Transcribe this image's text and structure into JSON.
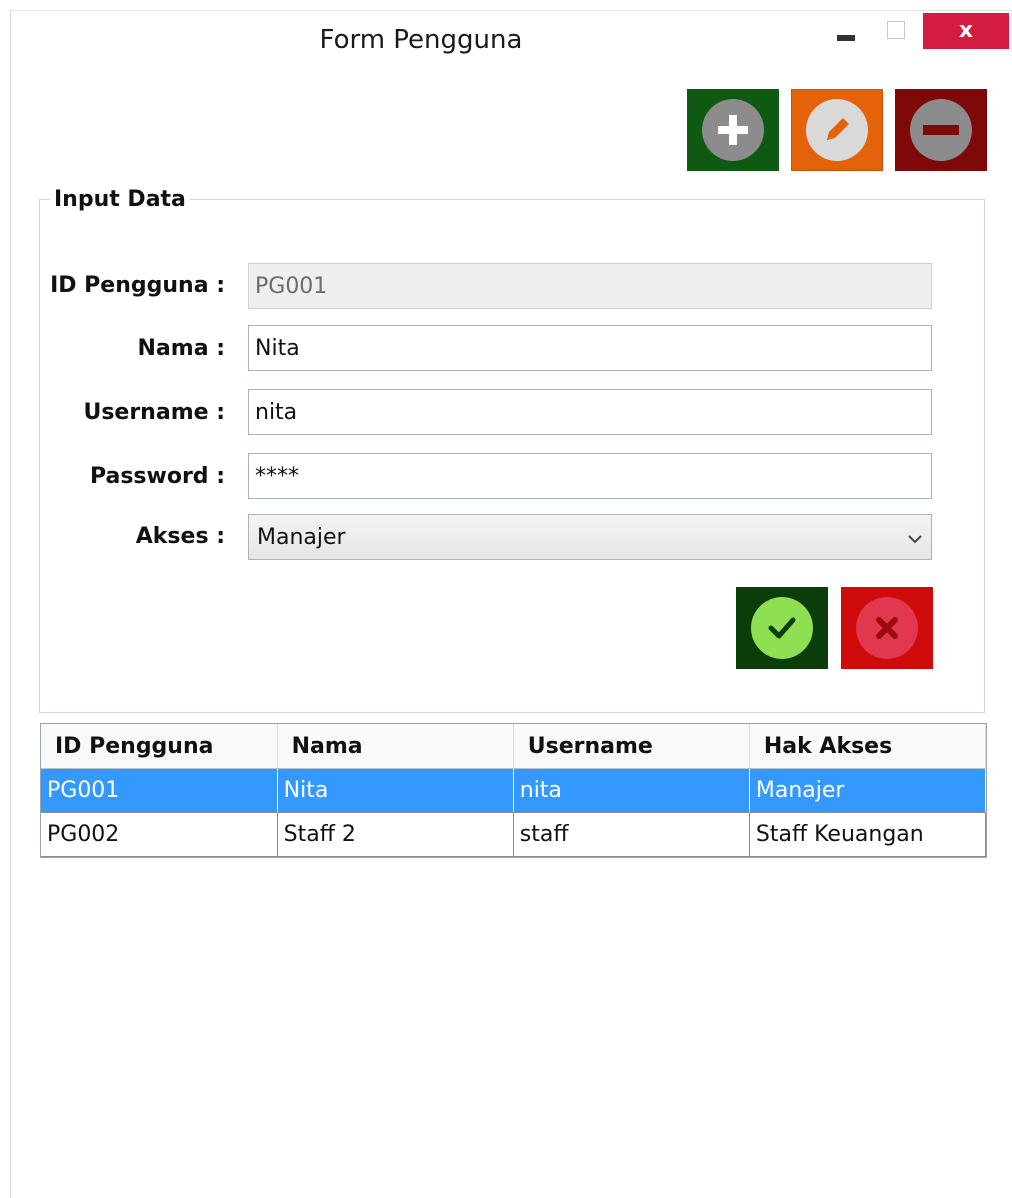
{
  "window": {
    "title": "Form Pengguna",
    "close_glyph": "x"
  },
  "toolbar": {
    "add_icon": "plus-circle-icon",
    "edit_icon": "pencil-circle-icon",
    "delete_icon": "minus-circle-icon",
    "colors": {
      "add_bg": "#0e5a12",
      "edit_bg": "#e4620a",
      "delete_bg": "#7d0909"
    }
  },
  "group": {
    "legend": "Input Data"
  },
  "form": {
    "id_label": "ID Pengguna :",
    "id_value": "PG001",
    "nama_label": "Nama :",
    "nama_value": "Nita",
    "username_label": "Username :",
    "username_value": "nita",
    "password_label": "Password :",
    "password_value": "****",
    "akses_label": "Akses :",
    "akses_value": "Manajer"
  },
  "actions": {
    "save_icon": "check-circle-icon",
    "cancel_icon": "x-circle-icon"
  },
  "table": {
    "headers": [
      "ID Pengguna",
      "Nama",
      "Username",
      "Hak Akses"
    ],
    "rows": [
      [
        "PG001",
        "Nita",
        "nita",
        "Manajer"
      ],
      [
        "PG002",
        "Staff 2",
        "staff",
        "Staff Keuangan"
      ]
    ],
    "selected_row": 0
  }
}
